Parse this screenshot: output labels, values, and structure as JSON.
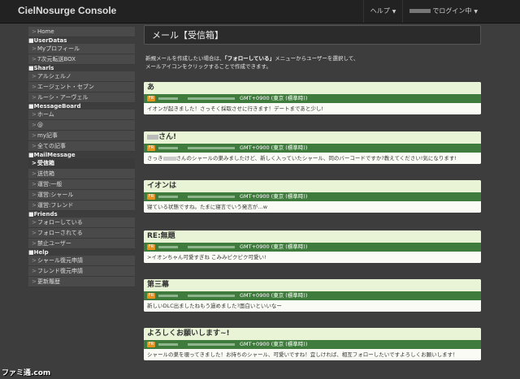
{
  "app": {
    "brand": "CielNosurge Console"
  },
  "topnav": {
    "help": "ヘルプ",
    "login": "でログイン中"
  },
  "sidebar": {
    "home": "Home",
    "sections": [
      {
        "title": "■UserDatas",
        "items": [
          "Myプロフィール",
          "7次元転送BOX"
        ]
      },
      {
        "title": "■Sharls",
        "items": [
          "アルシェルノ",
          "エージェント・セブン",
          "ルーシ・アーヴェル"
        ]
      },
      {
        "title": "■MessageBoard",
        "items": [
          "ホーム",
          "@",
          "my記事",
          "全ての記事"
        ]
      },
      {
        "title": "■MailMessage",
        "items": [
          "受信箱",
          "送信箱",
          "運営:一般",
          "運営:シャール",
          "運営:フレンド"
        ]
      },
      {
        "title": "■Friends",
        "items": [
          "フォローしている",
          "フォローされてる",
          "禁止ユーザー"
        ]
      },
      {
        "title": "■Help",
        "items": [
          "シャール復元申請",
          "フレンド復元申請",
          "更新履歴"
        ]
      }
    ]
  },
  "main": {
    "title": "メール【受信箱】",
    "intro_line1_a": "新規メールを作成したい場合は、",
    "intro_line1_b": "「フォローしている」",
    "intro_line1_c": "メニューからユーザーを選択して、",
    "intro_line2": "メールアイコンをクリックすることで作成できます。"
  },
  "messages": [
    {
      "title": "あ",
      "tag": "FR",
      "tz": "GMT+0900 (東京 (標準時))",
      "body": "イオンが起きました！さっそく採取させに行きます！デートまであと少し!"
    },
    {
      "title": "さん!",
      "tag": "FR",
      "tz": "GMT+0900 (東京 (標準時))",
      "body_a": "さっき",
      "body_b": "さんのシャールの巣みましたけど、新しく入っていたシャール、同のバーコードですか?教えてください!気になります!"
    },
    {
      "title": "イオンは",
      "tag": "FR",
      "tz": "GMT+0900 (東京 (標準時))",
      "body": "寝ている状態ですね。たまに寝言でいう発言が…w"
    },
    {
      "title": "RE:無題",
      "tag": "FR",
      "tz": "GMT+0900 (東京 (標準時))",
      "body": ">イオンちゃん可愛すぎね こみみピクピク可愛い!"
    },
    {
      "title": "第三幕",
      "tag": "FR",
      "tz": "GMT+0900 (東京 (標準時))",
      "body": "新しいDLC出ましたねもう過めました?面白いといいなー"
    },
    {
      "title": "よろしくお願いします~!",
      "tag": "FR",
      "tz": "GMT+0900 (東京 (標準時))",
      "body": "シャールの巣を覗ってきました！お持ちのシャール、可愛いですね！宜しければ、相互フォローしたいですよろしくお願いします！"
    }
  ],
  "watermark": "ファミ通.com"
}
